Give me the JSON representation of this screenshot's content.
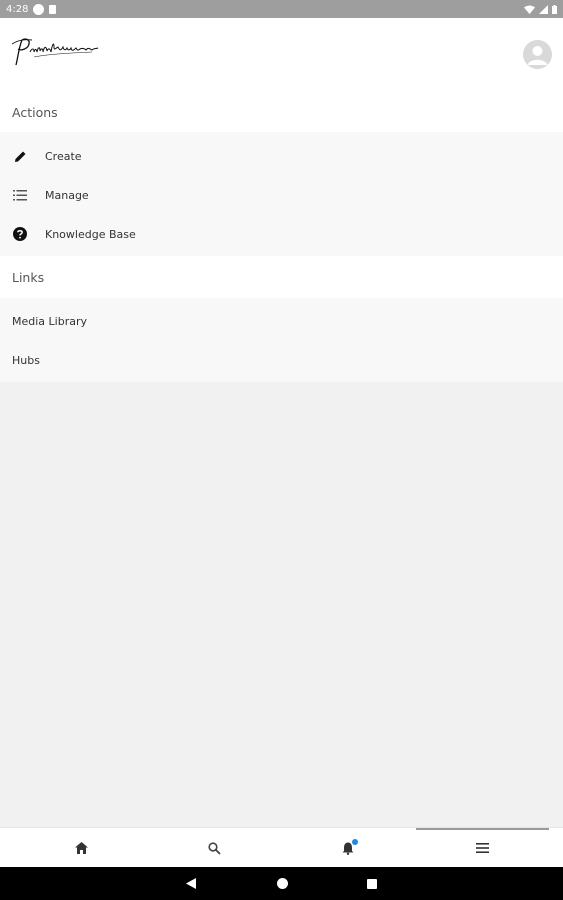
{
  "status_bar": {
    "time": "4:28"
  },
  "header": {
    "logo_text": "Paperhouse"
  },
  "actions_section": {
    "heading": "Actions",
    "items": [
      {
        "label": "Create",
        "icon": "pencil-icon"
      },
      {
        "label": "Manage",
        "icon": "list-icon"
      },
      {
        "label": "Knowledge Base",
        "icon": "help-circle-icon"
      }
    ]
  },
  "links_section": {
    "heading": "Links",
    "items": [
      {
        "label": "Media Library"
      },
      {
        "label": "Hubs"
      }
    ]
  },
  "bottom_nav": {
    "tabs": [
      {
        "icon": "home-icon"
      },
      {
        "icon": "search-icon"
      },
      {
        "icon": "bell-icon",
        "has_badge": true
      },
      {
        "icon": "menu-icon",
        "selected": true
      }
    ]
  },
  "colors": {
    "badge": "#1e88e5",
    "background": "#f1f1f1"
  }
}
